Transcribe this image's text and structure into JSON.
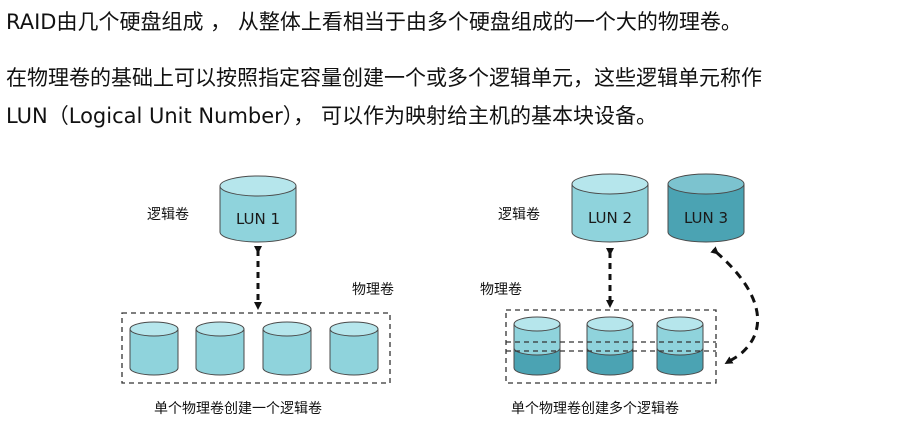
{
  "text": {
    "line1": "RAID由几个硬盘组成 ， 从整体上看相当于由多个硬盘组成的一个大的物理卷。",
    "line2": "在物理卷的基础上可以按照指定容量创建一个或多个逻辑单元，这些逻辑单元称作",
    "line3": "LUN（Logical Unit Number）， 可以作为映射给主机的基本块设备。"
  },
  "left_diagram": {
    "logical_label": "逻辑卷",
    "physical_label": "物理卷",
    "lun_label": "LUN 1",
    "caption": "单个物理卷创建一个逻辑卷"
  },
  "right_diagram": {
    "logical_label": "逻辑卷",
    "physical_label": "物理卷",
    "lun2_label": "LUN 2",
    "lun3_label": "LUN 3",
    "caption": "单个物理卷创建多个逻辑卷"
  },
  "colors": {
    "light_cylinder": "#8fd3dc",
    "light_top": "#b6e6ec",
    "dark_cylinder": "#4ba3b3",
    "dark_top": "#7cc3cf"
  }
}
